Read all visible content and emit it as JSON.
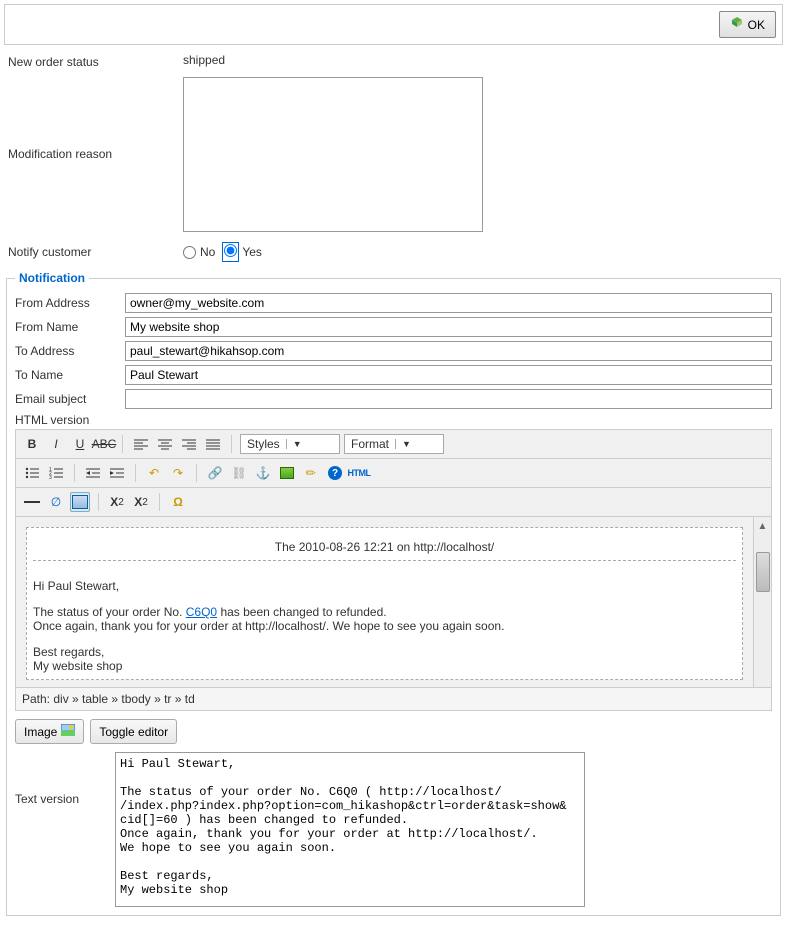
{
  "toolbar": {
    "ok_label": "OK"
  },
  "labels": {
    "new_order_status": "New order status",
    "modification_reason": "Modification reason",
    "notify_customer": "Notify customer",
    "notification_legend": "Notification",
    "from_address": "From Address",
    "from_name": "From Name",
    "to_address": "To Address",
    "to_name": "To Name",
    "email_subject": "Email subject",
    "html_version": "HTML version",
    "text_version": "Text version",
    "no": "No",
    "yes": "Yes",
    "image_btn": "Image",
    "toggle_btn": "Toggle editor"
  },
  "values": {
    "status": "shipped",
    "reason": "",
    "from_address": "owner@my_website.com",
    "from_name": "My website shop",
    "to_address": "paul_stewart@hikahsop.com",
    "to_name": "Paul Stewart",
    "email_subject": ""
  },
  "editor_dropdowns": {
    "styles": "Styles",
    "format": "Format"
  },
  "editor_content": {
    "header": "The 2010-08-26 12:21 on http://localhost/",
    "greeting": "Hi Paul Stewart,",
    "line1_a": "The status of your order No. ",
    "order_link": "C6Q0",
    "line1_b": " has been changed to refunded.",
    "line2": "Once again, thank you for your order at http://localhost/. We hope to see you again soon.",
    "regards": "Best regards,",
    "signature": "My website shop"
  },
  "editor_path": "Path: div » table » tbody » tr » td",
  "text_version_content": "Hi Paul Stewart,\n\nThe status of your order No. C6Q0 ( http://localhost/\n/index.php?index.php?option=com_hikashop&ctrl=order&task=show&\ncid[]=60 ) has been changed to refunded.\nOnce again, thank you for your order at http://localhost/.\nWe hope to see you again soon.\n\nBest regards,\nMy website shop"
}
